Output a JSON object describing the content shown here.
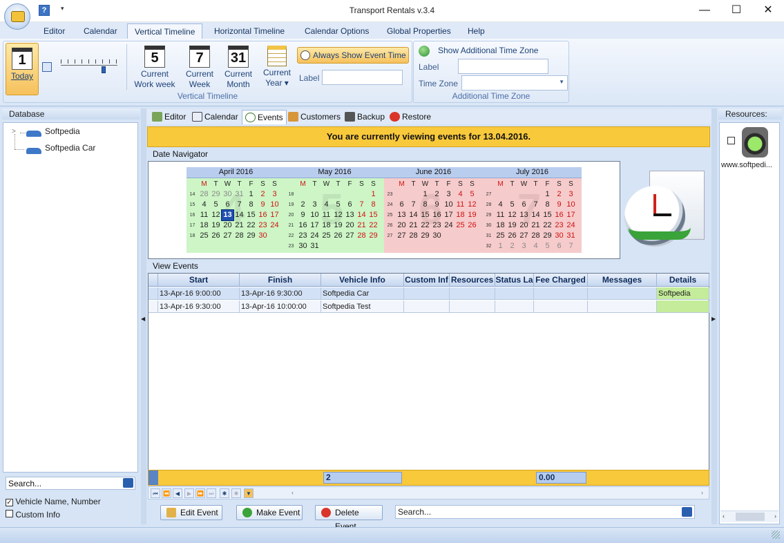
{
  "window": {
    "title": "Transport Rentals v.3.4",
    "minimize": "—",
    "maximize": "☐",
    "close": "✕"
  },
  "qat": {
    "help": "?",
    "dropdown": "▾"
  },
  "ribbon_tabs": [
    "Editor",
    "Calendar",
    "Vertical Timeline",
    "Horizontal Timeline",
    "Calendar Options",
    "Global Properties",
    "Help"
  ],
  "ribbon": {
    "today": {
      "num": "1",
      "label": "Today"
    },
    "buttons": [
      {
        "num": "5",
        "line1": "Current",
        "line2": "Work week"
      },
      {
        "num": "7",
        "line1": "Current",
        "line2": "Week"
      },
      {
        "num": "31",
        "line1": "Current",
        "line2": "Month"
      },
      {
        "num": "",
        "line1": "Current",
        "line2": "Year ▾"
      }
    ],
    "always_show": "Always Show Event Time",
    "label_caption": "Label",
    "group_vertical": "Vertical Timeline",
    "show_tz": "Show Additional Time Zone",
    "tz_label_caption": "Label",
    "tz_zone_caption": "Time Zone",
    "group_tz": "Additional Time Zone"
  },
  "left_panel": {
    "title": "Database",
    "tree": [
      "Softpedia",
      "Softpedia Car"
    ],
    "search_placeholder": "Search...",
    "options": [
      {
        "label": "Vehicle Name, Number",
        "checked": true
      },
      {
        "label": "Custom Info",
        "checked": false
      }
    ]
  },
  "right_panel": {
    "title": "Resources:",
    "item": "www.softpedi..."
  },
  "main_tabs": [
    "Editor",
    "Calendar",
    "Events",
    "Customers",
    "Backup",
    "Restore"
  ],
  "banner": "You are currently viewing events for 13.04.2016.",
  "date_navigator": {
    "label": "Date Navigator",
    "dow": [
      "M",
      "T",
      "W",
      "T",
      "F",
      "S",
      "S"
    ],
    "months": [
      {
        "name": "April 2016",
        "watermark": "4",
        "bg": "#cdf5c6",
        "weeks": [
          {
            "wk": "14",
            "days": [
              "28",
              "29",
              "30",
              "31",
              "1",
              "2",
              "3"
            ]
          },
          {
            "wk": "15",
            "days": [
              "4",
              "5",
              "6",
              "7",
              "8",
              "9",
              "10"
            ]
          },
          {
            "wk": "16",
            "days": [
              "11",
              "12",
              "13",
              "14",
              "15",
              "16",
              "17"
            ]
          },
          {
            "wk": "17",
            "days": [
              "18",
              "19",
              "20",
              "21",
              "22",
              "23",
              "24"
            ]
          },
          {
            "wk": "18",
            "days": [
              "25",
              "26",
              "27",
              "28",
              "29",
              "30",
              ""
            ]
          }
        ]
      },
      {
        "name": "May 2016",
        "watermark": "5",
        "bg": "#cdf5c6",
        "weeks": [
          {
            "wk": "18",
            "days": [
              "",
              "",
              "",
              "",
              "",
              "",
              "1"
            ]
          },
          {
            "wk": "19",
            "days": [
              "2",
              "3",
              "4",
              "5",
              "6",
              "7",
              "8"
            ]
          },
          {
            "wk": "20",
            "days": [
              "9",
              "10",
              "11",
              "12",
              "13",
              "14",
              "15"
            ]
          },
          {
            "wk": "21",
            "days": [
              "16",
              "17",
              "18",
              "19",
              "20",
              "21",
              "22"
            ]
          },
          {
            "wk": "22",
            "days": [
              "23",
              "24",
              "25",
              "26",
              "27",
              "28",
              "29"
            ]
          },
          {
            "wk": "23",
            "days": [
              "30",
              "31",
              "",
              "",
              "",
              "",
              ""
            ]
          }
        ]
      },
      {
        "name": "June 2016",
        "watermark": "6",
        "bg": "#f6cbcb",
        "weeks": [
          {
            "wk": "23",
            "days": [
              "",
              "",
              "1",
              "2",
              "3",
              "4",
              "5"
            ]
          },
          {
            "wk": "24",
            "days": [
              "6",
              "7",
              "8",
              "9",
              "10",
              "11",
              "12"
            ]
          },
          {
            "wk": "25",
            "days": [
              "13",
              "14",
              "15",
              "16",
              "17",
              "18",
              "19"
            ]
          },
          {
            "wk": "26",
            "days": [
              "20",
              "21",
              "22",
              "23",
              "24",
              "25",
              "26"
            ]
          },
          {
            "wk": "27",
            "days": [
              "27",
              "28",
              "29",
              "30",
              "",
              "",
              ""
            ]
          }
        ]
      },
      {
        "name": "July 2016",
        "watermark": "7",
        "bg": "#f6cbcb",
        "weeks": [
          {
            "wk": "27",
            "days": [
              "",
              "",
              "",
              "",
              "1",
              "2",
              "3"
            ]
          },
          {
            "wk": "28",
            "days": [
              "4",
              "5",
              "6",
              "7",
              "8",
              "9",
              "10"
            ]
          },
          {
            "wk": "29",
            "days": [
              "11",
              "12",
              "13",
              "14",
              "15",
              "16",
              "17"
            ]
          },
          {
            "wk": "30",
            "days": [
              "18",
              "19",
              "20",
              "21",
              "22",
              "23",
              "24"
            ]
          },
          {
            "wk": "31",
            "days": [
              "25",
              "26",
              "27",
              "28",
              "29",
              "30",
              "31"
            ]
          },
          {
            "wk": "32",
            "days": [
              "1",
              "2",
              "3",
              "4",
              "5",
              "6",
              "7"
            ]
          }
        ]
      }
    ]
  },
  "view_events": {
    "label": "View Events",
    "columns": [
      "Start",
      "Finish",
      "Vehicle Info",
      "Custom Inf",
      "Resources",
      "Status La",
      "Fee Charged",
      "Messages",
      "Details"
    ],
    "rows": [
      [
        "13-Apr-16 9:00:00",
        "13-Apr-16 9:30:00",
        "Softpedia Car",
        "",
        "",
        "",
        "",
        "",
        "Softpedia"
      ],
      [
        "13-Apr-16 9:30:00",
        "13-Apr-16 10:00:00",
        "Softpedia Test",
        "",
        "",
        "",
        "",
        "",
        ""
      ]
    ],
    "summary_count": "2",
    "summary_fee": "0.00"
  },
  "actions": {
    "edit": "Edit Event",
    "make": "Make Event",
    "delete": "Delete Event",
    "search_placeholder": "Search..."
  },
  "colors": {
    "accent": "#f9c93c",
    "ribbon": "#dfe9f7",
    "today": "#1f4fb0"
  }
}
